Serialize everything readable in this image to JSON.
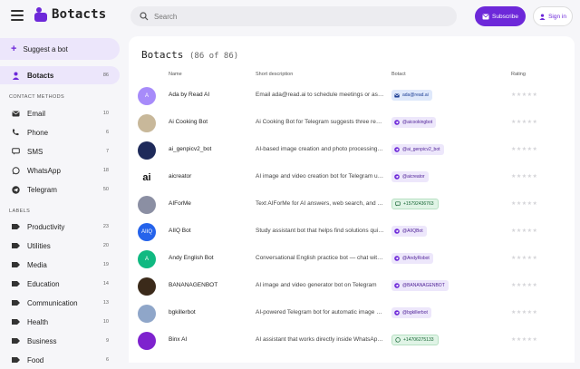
{
  "app": {
    "name": "Botacts"
  },
  "search": {
    "placeholder": "Search"
  },
  "header": {
    "subscribe": "Subscribe",
    "sign_in": "Sign in"
  },
  "sidebar": {
    "suggest": "Suggest a bot",
    "botacts": {
      "label": "Botacts",
      "count": "86"
    },
    "contact_heading": "CONTACT METHODS",
    "contacts": [
      {
        "label": "Email",
        "count": "10",
        "icon": "email-icon"
      },
      {
        "label": "Phone",
        "count": "6",
        "icon": "phone-icon"
      },
      {
        "label": "SMS",
        "count": "7",
        "icon": "sms-icon"
      },
      {
        "label": "WhatsApp",
        "count": "18",
        "icon": "whatsapp-icon"
      },
      {
        "label": "Telegram",
        "count": "50",
        "icon": "telegram-icon"
      }
    ],
    "labels_heading": "LABELS",
    "labels": [
      {
        "label": "Productivity",
        "count": "23"
      },
      {
        "label": "Utilities",
        "count": "20"
      },
      {
        "label": "Media",
        "count": "19"
      },
      {
        "label": "Education",
        "count": "14"
      },
      {
        "label": "Communication",
        "count": "13"
      },
      {
        "label": "Health",
        "count": "10"
      },
      {
        "label": "Business",
        "count": "9"
      },
      {
        "label": "Food",
        "count": "6"
      }
    ]
  },
  "main": {
    "title": "Botacts",
    "count": "(86 of 86)",
    "columns": {
      "name": "Name",
      "description": "Short description",
      "botact": "Botact",
      "rating": "Rating"
    },
    "rows": [
      {
        "name": "Ada by Read AI",
        "desc": "Email ada@read.ai to schedule meetings or ask questions",
        "botact": "ada@read.ai",
        "type": "email",
        "avatar_color": "#a78bfa",
        "avatar_text": "A"
      },
      {
        "name": "Ai Cooking Bot",
        "desc": "Ai Cooking Bot for Telegram suggests three recipes",
        "botact": "@aicookingbot",
        "type": "telegram",
        "avatar_color": "#c8b89a",
        "avatar_text": ""
      },
      {
        "name": "ai_genpicv2_bot",
        "desc": "AI-based image creation and photo processing bot",
        "botact": "@ai_genpicv2_bot",
        "type": "telegram",
        "avatar_color": "#1e2a5a",
        "avatar_text": ""
      },
      {
        "name": "aicreator",
        "desc": "AI image and video creation bot for Telegram users",
        "botact": "@aicreator",
        "type": "telegram",
        "avatar_color": "#ffffff",
        "avatar_text": "ai"
      },
      {
        "name": "AIForMe",
        "desc": "Text AIForMe for AI answers, web search, and more",
        "botact": "+15792436763",
        "type": "sms",
        "avatar_color": "#8b8fa3",
        "avatar_text": ""
      },
      {
        "name": "AIIQ Bot",
        "desc": "Study assistant bot that helps find solutions quickly",
        "botact": "@AIIQBot",
        "type": "telegram",
        "avatar_color": "#2563eb",
        "avatar_text": "AIIQ"
      },
      {
        "name": "Andy English Bot",
        "desc": "Conversational English practice bot — chat with Andy",
        "botact": "@AndyRobot",
        "type": "telegram",
        "avatar_color": "#10b981",
        "avatar_text": "A"
      },
      {
        "name": "BANANAGENBOT",
        "desc": "AI image and video generator bot on Telegram",
        "botact": "@BANANAGENBOT",
        "type": "telegram",
        "avatar_color": "#3b2a1a",
        "avatar_text": ""
      },
      {
        "name": "bgkillerbot",
        "desc": "AI-powered Telegram bot for automatic image background removal",
        "botact": "@bgkillerbot",
        "type": "telegram",
        "avatar_color": "#8fa6c9",
        "avatar_text": ""
      },
      {
        "name": "Binx AI",
        "desc": "AI assistant that works directly inside WhatsApp chats",
        "botact": "+14706275133",
        "type": "whatsapp",
        "avatar_color": "#7e22ce",
        "avatar_text": ""
      }
    ]
  },
  "colors": {
    "accent": "#6d28d9",
    "accent_light": "#ece6fb"
  }
}
